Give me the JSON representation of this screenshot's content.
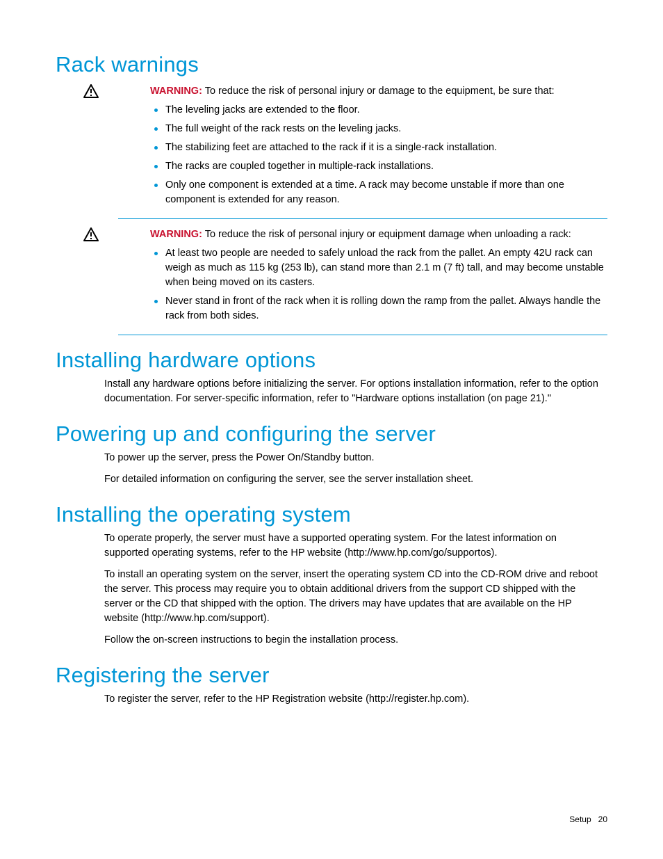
{
  "sections": {
    "rack": {
      "heading": "Rack warnings",
      "warning1": {
        "lead": "WARNING:",
        "intro": "  To reduce the risk of personal injury or damage to the equipment, be sure that:",
        "items": [
          "The leveling jacks are extended to the floor.",
          "The full weight of the rack rests on the leveling jacks.",
          "The stabilizing feet are attached to the rack if it is a single-rack installation.",
          "The racks are coupled together in multiple-rack installations.",
          "Only one component is extended at a time. A rack may become unstable if more than one component is extended for any reason."
        ]
      },
      "warning2": {
        "lead": "WARNING:",
        "intro": "  To reduce the risk of personal injury or equipment damage when unloading a rack:",
        "items": [
          "At least two people are needed to safely unload the rack from the pallet. An empty 42U rack can weigh as much as 115 kg (253 lb), can stand more than 2.1 m (7 ft) tall, and may become unstable when being moved on its casters.",
          "Never stand in front of the rack when it is rolling down the ramp from the pallet. Always handle the rack from both sides."
        ]
      }
    },
    "hardware": {
      "heading": "Installing hardware options",
      "p1": "Install any hardware options before initializing the server. For options installation information, refer to the option documentation. For server-specific information, refer to \"Hardware options installation (on page 21).\""
    },
    "powering": {
      "heading": "Powering up and configuring the server",
      "p1": "To power up the server, press the Power On/Standby button.",
      "p2": "For detailed information on configuring the server, see the server installation sheet."
    },
    "os": {
      "heading": "Installing the operating system",
      "p1": "To operate properly, the server must have a supported operating system. For the latest information on supported operating systems, refer to the HP website (http://www.hp.com/go/supportos).",
      "p2": "To install an operating system on the server, insert the operating system CD into the CD-ROM drive and reboot the server. This process may require you to obtain additional drivers from the support CD shipped with the server or the CD that shipped with the option. The drivers may have updates that are available on the HP website (http://www.hp.com/support).",
      "p3": "Follow the on-screen instructions to begin the installation process."
    },
    "register": {
      "heading": "Registering the server",
      "p1": "To register the server, refer to the HP Registration website (http://register.hp.com)."
    }
  },
  "footer": {
    "label": "Setup",
    "page": "20"
  }
}
